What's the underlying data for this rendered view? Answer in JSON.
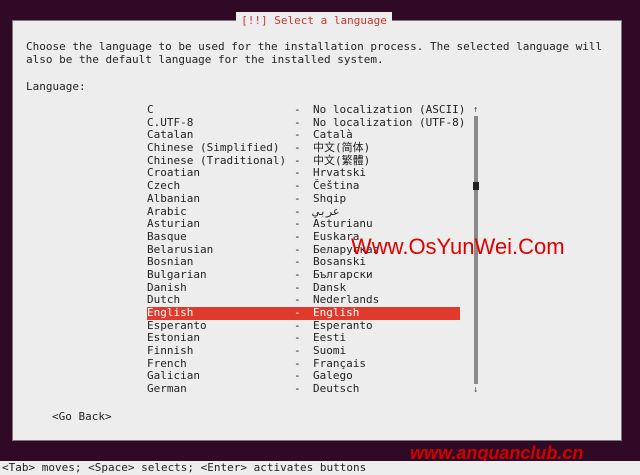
{
  "dialog": {
    "title": "[!!] Select a language",
    "description": "Choose the language to be used for the installation process. The selected language will\nalso be the default language for the installed system.",
    "language_label": "Language:",
    "go_back_label": "<Go Back>"
  },
  "languages": [
    {
      "name": "C",
      "sep": "-",
      "localized": "No localization (ASCII)"
    },
    {
      "name": "C.UTF-8",
      "sep": "-",
      "localized": "No localization (UTF-8)"
    },
    {
      "name": "Catalan",
      "sep": "-",
      "localized": "Català"
    },
    {
      "name": "Chinese (Simplified)",
      "sep": "-",
      "localized": "中文(简体)"
    },
    {
      "name": "Chinese (Traditional)",
      "sep": "-",
      "localized": "中文(繁體)"
    },
    {
      "name": "Croatian",
      "sep": "-",
      "localized": "Hrvatski"
    },
    {
      "name": "Czech",
      "sep": "-",
      "localized": "Čeština"
    },
    {
      "name": "Albanian",
      "sep": "-",
      "localized": "Shqip"
    },
    {
      "name": "Arabic",
      "sep": "-",
      "localized": "عربي"
    },
    {
      "name": "Asturian",
      "sep": "-",
      "localized": "Asturianu"
    },
    {
      "name": "Basque",
      "sep": "-",
      "localized": "Euskara"
    },
    {
      "name": "Belarusian",
      "sep": "-",
      "localized": "Беларуская"
    },
    {
      "name": "Bosnian",
      "sep": "-",
      "localized": "Bosanski"
    },
    {
      "name": "Bulgarian",
      "sep": "-",
      "localized": "Български"
    },
    {
      "name": "Danish",
      "sep": "-",
      "localized": "Dansk"
    },
    {
      "name": "Dutch",
      "sep": "-",
      "localized": "Nederlands"
    },
    {
      "name": "English",
      "sep": "-",
      "localized": "English",
      "selected": true
    },
    {
      "name": "Esperanto",
      "sep": "-",
      "localized": "Esperanto"
    },
    {
      "name": "Estonian",
      "sep": "-",
      "localized": "Eesti"
    },
    {
      "name": "Finnish",
      "sep": "-",
      "localized": "Suomi"
    },
    {
      "name": "French",
      "sep": "-",
      "localized": "Français"
    },
    {
      "name": "Galician",
      "sep": "-",
      "localized": "Galego"
    },
    {
      "name": "German",
      "sep": "-",
      "localized": "Deutsch"
    }
  ],
  "scrollbar": {
    "up_arrow": "↑",
    "down_arrow": "↓"
  },
  "footer": {
    "hint": "<Tab> moves; <Space> selects; <Enter> activates buttons"
  },
  "watermarks": {
    "top": "Www.OsYunWei.Com",
    "bottom": "www.anquanclub.cn"
  },
  "colors": {
    "background": "#300a24",
    "dialog": "#ededed",
    "selection": "#e03a2c",
    "title": "#c0392b"
  }
}
